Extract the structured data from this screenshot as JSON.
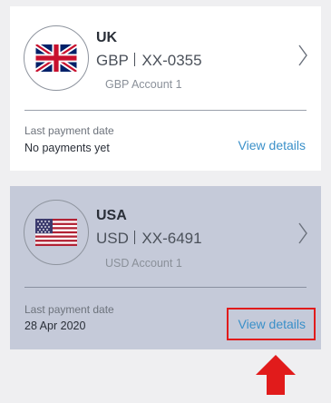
{
  "accounts": [
    {
      "country": "UK",
      "currency": "GBP",
      "account_number": "XX-0355",
      "account_name": "GBP Account 1",
      "last_payment_label": "Last payment date",
      "last_payment_value": "No payments yet",
      "view_details": "View details",
      "flag_icon": "uk-flag-icon",
      "selected": false
    },
    {
      "country": "USA",
      "currency": "USD",
      "account_number": "XX-6491",
      "account_name": "USD Account 1",
      "last_payment_label": "Last payment date",
      "last_payment_value": "28 Apr 2020",
      "view_details": "View details",
      "flag_icon": "us-flag-icon",
      "selected": true
    }
  ],
  "annotation": {
    "highlight_color": "#e11b1b",
    "arrow_icon": "arrow-up-icon"
  },
  "colors": {
    "link": "#3a90c9",
    "selected_card_bg": "#c5cad9",
    "page_bg": "#efeff1"
  }
}
